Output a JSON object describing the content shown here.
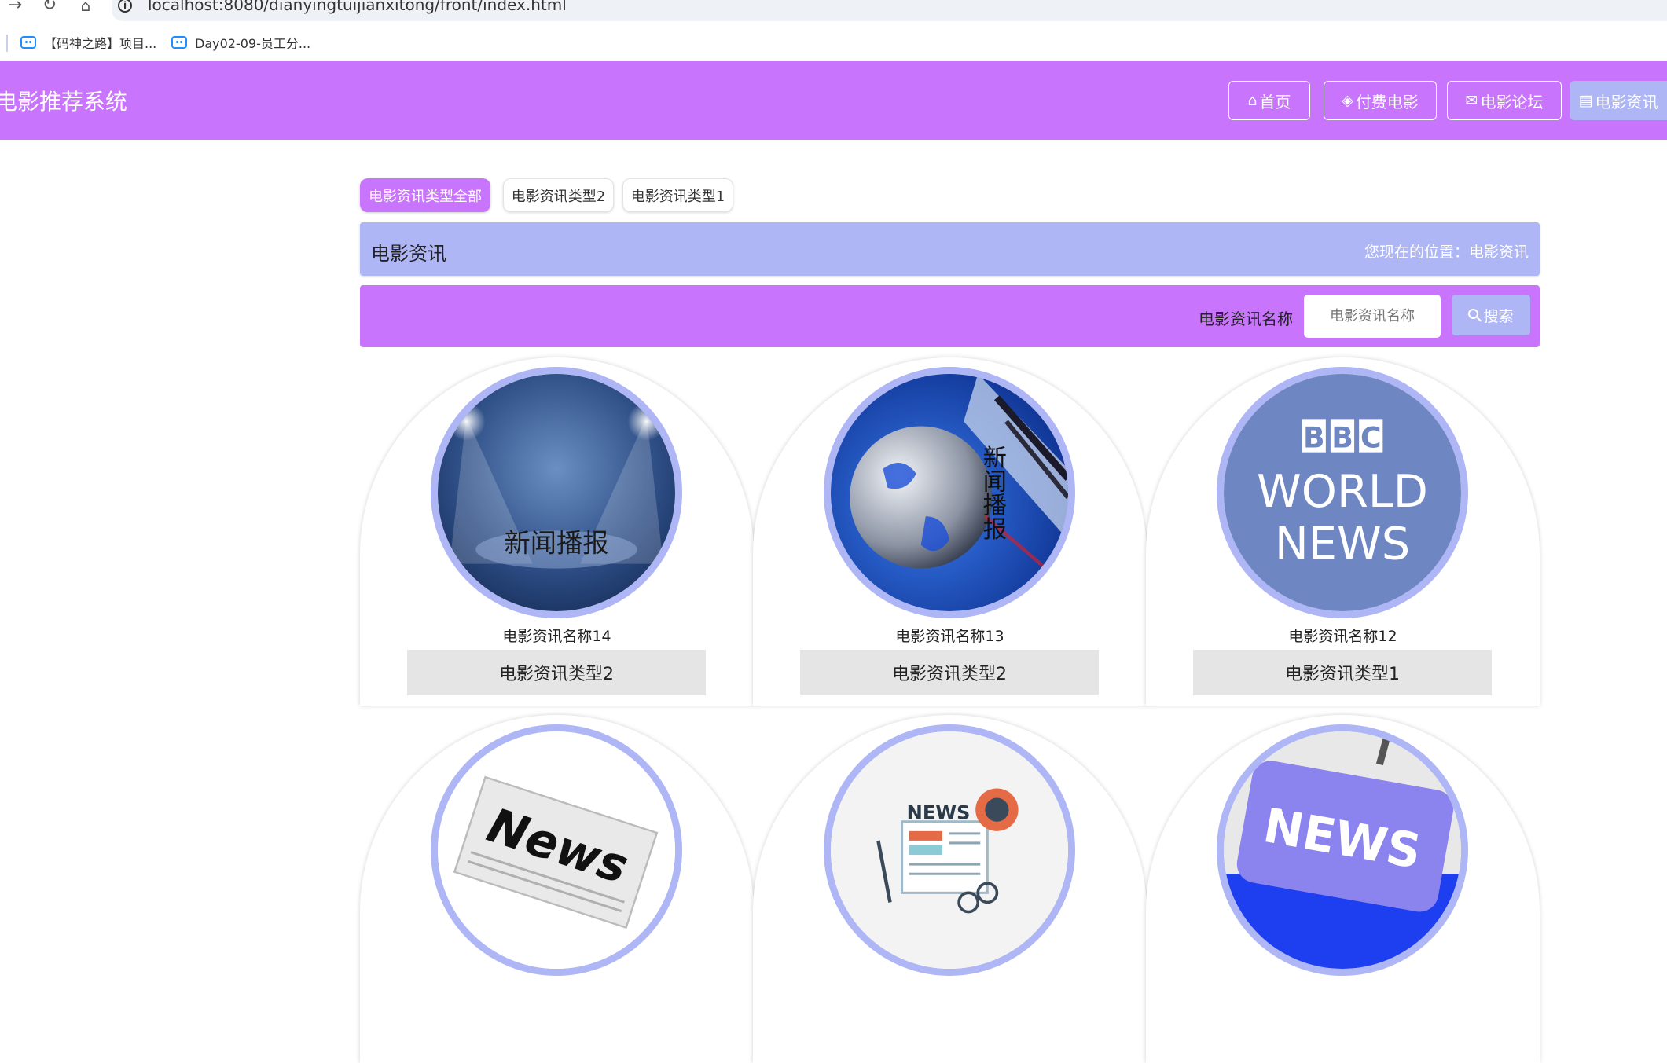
{
  "browser": {
    "url": "localhost:8080/dianyingtuijianxitong/front/index.html",
    "bookmarks": [
      {
        "label": "【码神之路】项目..."
      },
      {
        "label": "Day02-09-员工分..."
      }
    ]
  },
  "header": {
    "site_title": "电影推荐系统",
    "nav": [
      {
        "label": "首页",
        "icon": "home-icon"
      },
      {
        "label": "付费电影",
        "icon": "layers-icon"
      },
      {
        "label": "电影论坛",
        "icon": "mail-icon"
      },
      {
        "label": "电影资讯",
        "icon": "newspaper-icon",
        "active": true
      }
    ]
  },
  "filters": {
    "tabs": [
      {
        "label": "电影资讯类型全部",
        "active": true
      },
      {
        "label": "电影资讯类型2",
        "active": false
      },
      {
        "label": "电影资讯类型1",
        "active": false
      }
    ]
  },
  "section": {
    "title": "电影资讯",
    "breadcrumb": "您现在的位置：电影资讯"
  },
  "search": {
    "label": "电影资讯名称",
    "placeholder": "电影资讯名称",
    "value": "",
    "button_label": "搜索"
  },
  "news": [
    {
      "name": "电影资讯名称14",
      "type": "电影资讯类型2",
      "image_caption": "新闻播报"
    },
    {
      "name": "电影资讯名称13",
      "type": "电影资讯类型2",
      "image_caption": "新闻播报"
    },
    {
      "name": "电影资讯名称12",
      "type": "电影资讯类型1",
      "image_caption": "BBC WORLD NEWS"
    },
    {
      "name": "",
      "type": "",
      "image_caption": "News"
    },
    {
      "name": "",
      "type": "",
      "image_caption": "NEWS"
    },
    {
      "name": "",
      "type": "",
      "image_caption": "NEWS"
    }
  ],
  "colors": {
    "primary": "#c874fc",
    "secondary": "#aeb6f6",
    "card_type_bg": "#e5e5e5"
  }
}
